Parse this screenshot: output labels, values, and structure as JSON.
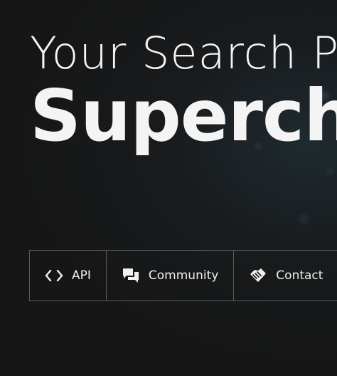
{
  "hero": {
    "line1": "Your Search P",
    "line2": "Superch"
  },
  "nav": {
    "items": [
      {
        "label": "API",
        "icon": "code-icon"
      },
      {
        "label": "Community",
        "icon": "chat-bubbles-icon"
      },
      {
        "label": "Contact",
        "icon": "handshake-icon"
      }
    ]
  }
}
